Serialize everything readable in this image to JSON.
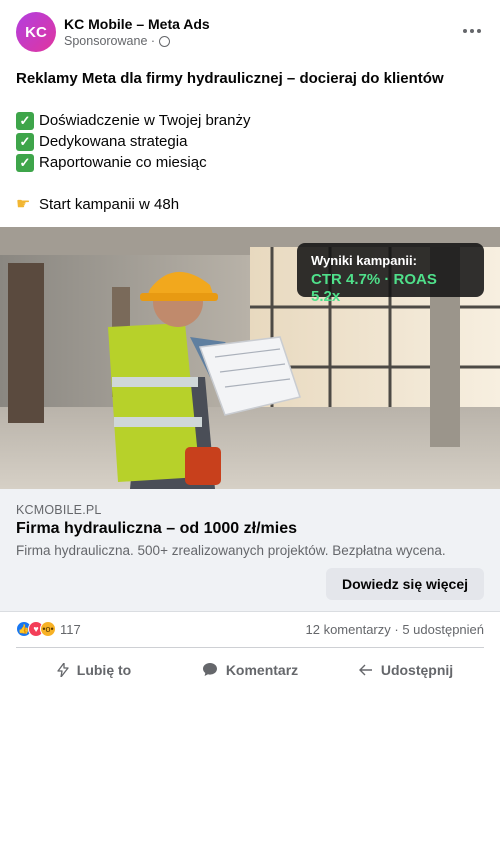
{
  "post": {
    "page_name": "KC Mobile – Meta Ads",
    "avatar_initials": "KC",
    "sponsored_label": "Sponsorowane ·",
    "more_icon": "more-horizontal-icon",
    "headline": "Reklamy Meta dla firmy hydraulicznej – docieraj do klientów",
    "bullets": [
      "Doświadczenie w Twojej branży",
      "Dedykowana strategia",
      "Raportowanie co miesiąc"
    ],
    "cta_line": "Start kampanii w 48h"
  },
  "media": {
    "overlay_title": "Wyniki kampanii:",
    "overlay_metrics": "CTR 4.7% · ROAS 5.2x",
    "metrics_color": "#4fe08a"
  },
  "link_card": {
    "domain": "KCMOBILE.PL",
    "title": "Firma hydrauliczna – od 1000 zł/mies",
    "description": "Firma hydrauliczna. 500+ zrealizowanych projektów. Bezpłatna wycena.",
    "button_label": "Dowiedz się więcej"
  },
  "engagement": {
    "reaction_count": "117",
    "comments_shares": "12 komentarzy · 5 udostępnień"
  },
  "actions": {
    "like": "Lubię to",
    "comment": "Komentarz",
    "share": "Udostępnij"
  }
}
